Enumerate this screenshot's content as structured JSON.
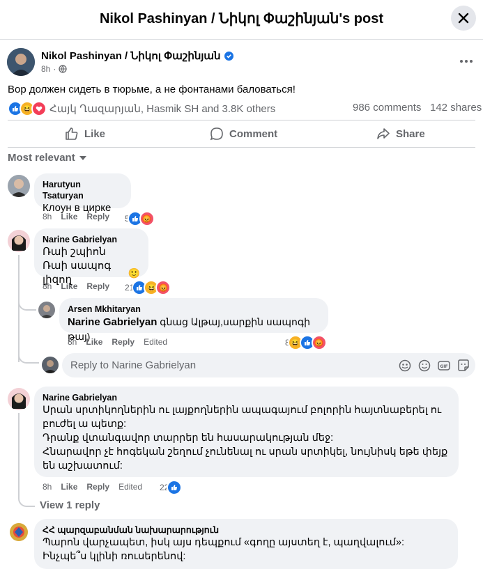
{
  "header": {
    "title": "Nikol Pashinyan / Նիկոլ Փաշինյան's post"
  },
  "post": {
    "author": "Nikol Pashinyan / Նիկոլ Փաշինյան",
    "time": "8h",
    "text": "Вор должен сидеть в тюрьме, а не фонтанами баловаться!",
    "reactions_text": "Հայկ Ղազարյան, Hasmik SH and 3.8K others",
    "comments_count": "986 comments",
    "shares_count": "142 shares"
  },
  "actions": {
    "like": "Like",
    "comment": "Comment",
    "share": "Share"
  },
  "sort": {
    "label": "Most relevant"
  },
  "comment_labels": {
    "like": "Like",
    "reply": "Reply",
    "edited": "Edited"
  },
  "comments": [
    {
      "name": "Harutyun Tsaturyan",
      "text": "Клоун в цирке",
      "time": "8h",
      "count": "5"
    },
    {
      "name": "Narine Gabrielyan",
      "line1": "Ռաի շպիոն",
      "line2": "Ռաի սապոգ լիզող",
      "emoji": "🙂",
      "time": "8h",
      "count": "21"
    },
    {
      "name": "Arsen Mkhitaryan",
      "mention": "Narine Gabrielyan",
      "text": " գնաց Ալթայ,սարքին սապոգի թայ)",
      "time": "8h",
      "count": "8"
    },
    {
      "name": "Narine Gabrielyan",
      "p1": "Սրան սրտիկողներին ու լայքողներին ապագայում բոլորին հայտնաբերել ու բուժել ա պետք:",
      "p2": "Դրանք վտանգավոր տարրեր են հասարակության մեջ:",
      "p3": "Հնարավոր չէ հոգեկան շեղում չունենալ ու սրան սրտիկել, նույնիսկ եթե փեյք են աշխատում:",
      "time": "8h",
      "count": "22"
    },
    {
      "name": "ՀՀ պարզաբանման նախարարություն",
      "text": "Պարոն վարչապետ, իսկ այս դեպքում «գողը այստեղ է, պաղվալում»: Ինչպե՞ս կլինի ռուսերենով:"
    }
  ],
  "reply_placeholder": "Reply to Narine Gabrielyan",
  "view_replies": "View 1 reply",
  "colors": {
    "like": "#1b74e4",
    "angry": "#f25268",
    "haha": "#f7b125",
    "love": "#f33e58",
    "verified": "#1b74e4"
  }
}
